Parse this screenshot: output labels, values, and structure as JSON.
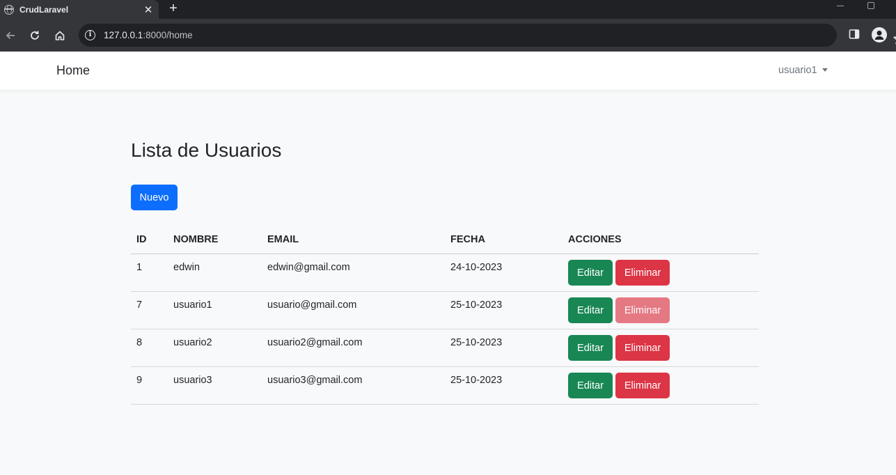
{
  "browser": {
    "tab_title": "CrudLaravel",
    "tab_close": "✕",
    "new_tab": "+",
    "url_host": "127.0.0.1",
    "url_rest": ":8000/home",
    "icons": [
      "back-icon",
      "reload-icon",
      "home-icon",
      "site-info-icon",
      "bookmark-star-icon",
      "side-panel-icon",
      "profile-icon"
    ]
  },
  "navbar": {
    "brand": "Home",
    "user": "usuario1"
  },
  "main": {
    "title": "Lista de Usuarios",
    "new_button": "Nuevo",
    "table": {
      "headers": {
        "id": "ID",
        "name": "NOMBRE",
        "email": "EMAIL",
        "date": "FECHA",
        "actions": "ACCIONES"
      },
      "rows": [
        {
          "id": "1",
          "name": "edwin",
          "email": "edwin@gmail.com",
          "date": "24-10-2023",
          "edit": "Editar",
          "delete": "Eliminar",
          "delete_disabled": false
        },
        {
          "id": "7",
          "name": "usuario1",
          "email": "usuario@gmail.com",
          "date": "25-10-2023",
          "edit": "Editar",
          "delete": "Eliminar",
          "delete_disabled": true
        },
        {
          "id": "8",
          "name": "usuario2",
          "email": "usuario2@gmail.com",
          "date": "25-10-2023",
          "edit": "Editar",
          "delete": "Eliminar",
          "delete_disabled": false
        },
        {
          "id": "9",
          "name": "usuario3",
          "email": "usuario3@gmail.com",
          "date": "25-10-2023",
          "edit": "Editar",
          "delete": "Eliminar",
          "delete_disabled": false
        }
      ]
    }
  },
  "colors": {
    "primary": "#0d6efd",
    "success": "#198754",
    "danger": "#dc3545",
    "page_bg": "#f8f9fa"
  }
}
